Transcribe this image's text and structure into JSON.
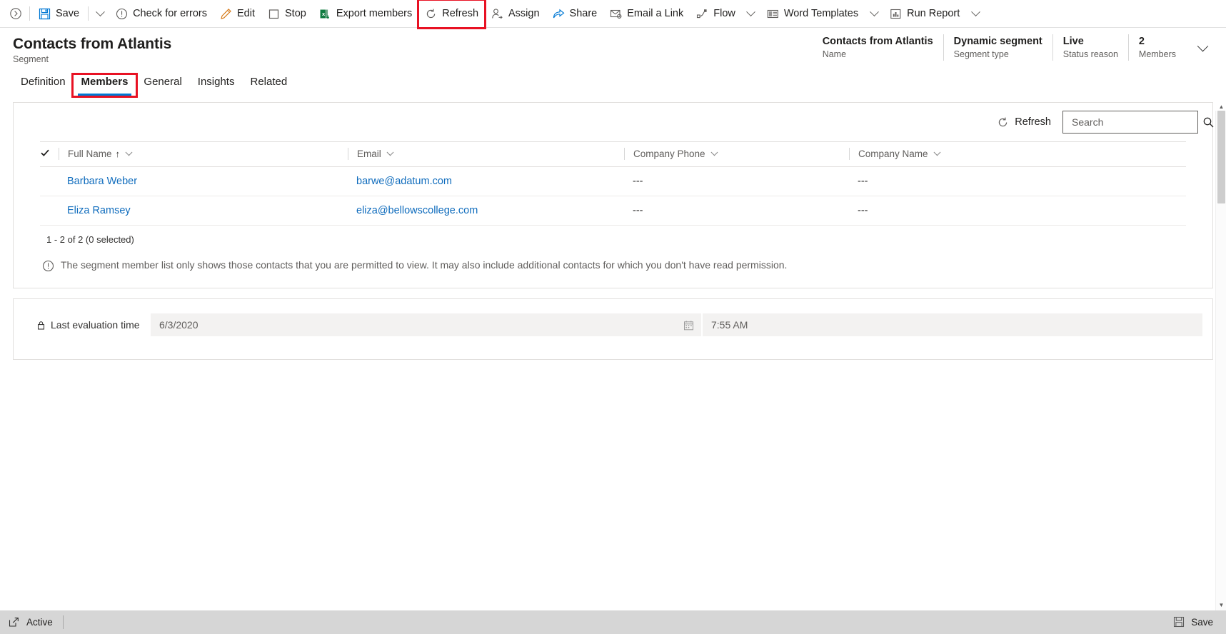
{
  "commandbar": {
    "back_icon": "back-chevron-icon",
    "items": [
      {
        "id": "save",
        "label": "Save",
        "icon": "save-icon",
        "has_chevron_after": true
      },
      {
        "id": "check-for-errors",
        "label": "Check for errors",
        "icon": "error-circle-icon"
      },
      {
        "id": "edit",
        "label": "Edit",
        "icon": "pencil-icon"
      },
      {
        "id": "stop",
        "label": "Stop",
        "icon": "stop-square-icon"
      },
      {
        "id": "export-members",
        "label": "Export members",
        "icon": "excel-icon"
      },
      {
        "id": "refresh",
        "label": "Refresh",
        "icon": "refresh-icon",
        "highlighted": true
      },
      {
        "id": "assign",
        "label": "Assign",
        "icon": "assign-person-icon"
      },
      {
        "id": "share",
        "label": "Share",
        "icon": "share-icon"
      },
      {
        "id": "email-a-link",
        "label": "Email a Link",
        "icon": "email-link-icon"
      },
      {
        "id": "flow",
        "label": "Flow",
        "icon": "flow-icon",
        "chevron": true
      },
      {
        "id": "word-templates",
        "label": "Word Templates",
        "icon": "word-template-icon",
        "chevron": true
      },
      {
        "id": "run-report",
        "label": "Run Report",
        "icon": "run-report-icon",
        "chevron": true
      }
    ]
  },
  "header": {
    "title": "Contacts from Atlantis",
    "subtitle": "Segment",
    "facts": [
      {
        "value": "Contacts from Atlantis",
        "label": "Name"
      },
      {
        "value": "Dynamic segment",
        "label": "Segment type"
      },
      {
        "value": "Live",
        "label": "Status reason"
      },
      {
        "value": "2",
        "label": "Members"
      }
    ],
    "collapse_icon": "chevron-down-icon"
  },
  "tabs": [
    {
      "id": "definition",
      "label": "Definition",
      "selected": false
    },
    {
      "id": "members",
      "label": "Members",
      "selected": true,
      "highlighted": true
    },
    {
      "id": "general",
      "label": "General",
      "selected": false
    },
    {
      "id": "insights",
      "label": "Insights",
      "selected": false
    },
    {
      "id": "related",
      "label": "Related",
      "selected": false
    }
  ],
  "grid": {
    "refresh_label": "Refresh",
    "refresh_icon": "refresh-icon",
    "search_placeholder": "Search",
    "search_value": "",
    "search_icon": "search-icon",
    "select_all_icon": "checkmark-icon",
    "columns": [
      {
        "label": "Full Name",
        "sorted": true,
        "sort_arrow": "↑"
      },
      {
        "label": "Email"
      },
      {
        "label": "Company Phone"
      },
      {
        "label": "Company Name"
      }
    ],
    "rows": [
      {
        "full_name": "Barbara Weber",
        "email": "barwe@adatum.com",
        "company_phone": "---",
        "company_name": "---"
      },
      {
        "full_name": "Eliza Ramsey",
        "email": "eliza@bellowscollege.com",
        "company_phone": "---",
        "company_name": "---"
      }
    ],
    "rowcount": "1 - 2 of 2 (0 selected)",
    "note_icon": "info-circle-icon",
    "note": "The segment member list only shows those contacts that you are permitted to view. It may also include additional contacts for which you don't have read permission."
  },
  "fields": {
    "last_evaluation": {
      "lock_icon": "lock-icon",
      "label": "Last evaluation time",
      "date_value": "6/3/2020",
      "date_icon": "calendar-icon",
      "time_value": "7:55 AM"
    }
  },
  "statusbar": {
    "popout_icon": "popout-icon",
    "state": "Active",
    "save_label": "Save",
    "save_icon": "save-icon"
  },
  "colors": {
    "accent": "#0078d4",
    "link": "#0f6cbd",
    "highlight": "#e81123",
    "excel_green": "#107c41"
  }
}
